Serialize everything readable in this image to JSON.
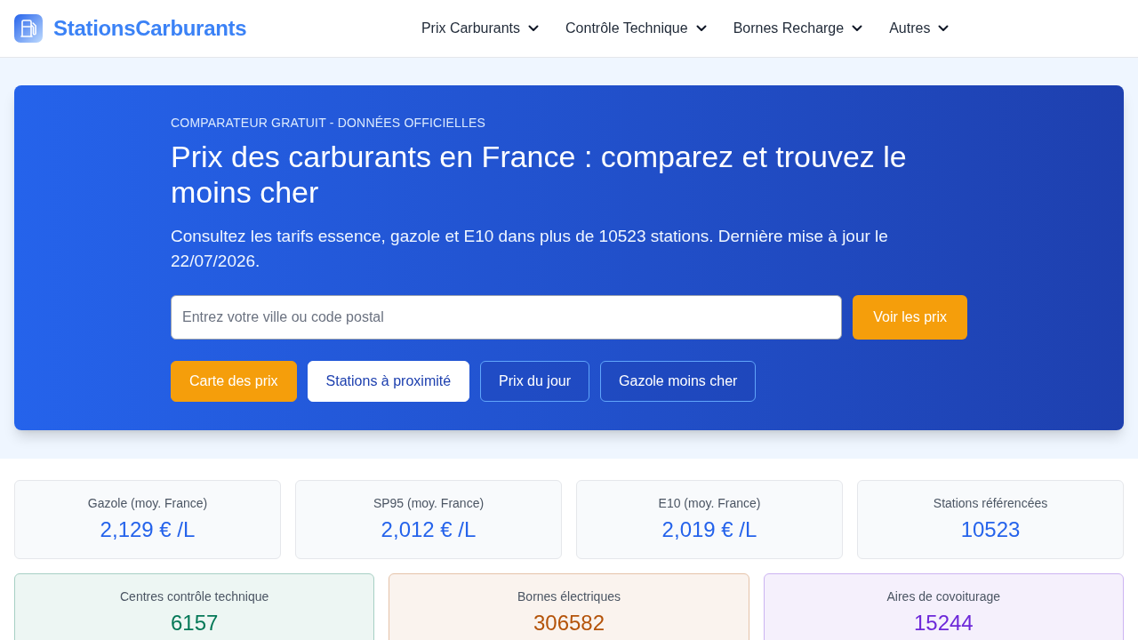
{
  "header": {
    "brand": "StationsCarburants",
    "nav": [
      {
        "label": "Prix Carburants"
      },
      {
        "label": "Contrôle Technique"
      },
      {
        "label": "Bornes Recharge"
      },
      {
        "label": "Autres"
      }
    ]
  },
  "hero": {
    "eyebrow": "COMPARATEUR GRATUIT - DONNÉES OFFICIELLES",
    "title": "Prix des carburants en France : comparez et trouvez le moins cher",
    "subtitle": "Consultez les tarifs essence, gazole et E10 dans plus de 10523 stations. Dernière mise à jour le 22/07/2026.",
    "search": {
      "placeholder": "Entrez votre ville ou code postal",
      "button": "Voir les prix"
    },
    "links": [
      {
        "label": "Carte des prix",
        "kind": "primary"
      },
      {
        "label": "Stations à proximité",
        "kind": "light"
      },
      {
        "label": "Prix du jour",
        "kind": "outline"
      },
      {
        "label": "Gazole moins cher",
        "kind": "outline"
      }
    ]
  },
  "fuel_stats": [
    {
      "label": "Gazole (moy. France)",
      "value": "2,129 € /L"
    },
    {
      "label": "SP95 (moy. France)",
      "value": "2,012 € /L"
    },
    {
      "label": "E10 (moy. France)",
      "value": "2,019 € /L"
    },
    {
      "label": "Stations référencées",
      "value": "10523"
    }
  ],
  "network_stats": [
    {
      "label": "Centres contrôle technique",
      "value": "6157",
      "color": "#047857"
    },
    {
      "label": "Bornes électriques",
      "value": "306582",
      "color": "#b45309"
    },
    {
      "label": "Aires de covoiturage",
      "value": "15244",
      "color": "#6d28d9"
    }
  ]
}
